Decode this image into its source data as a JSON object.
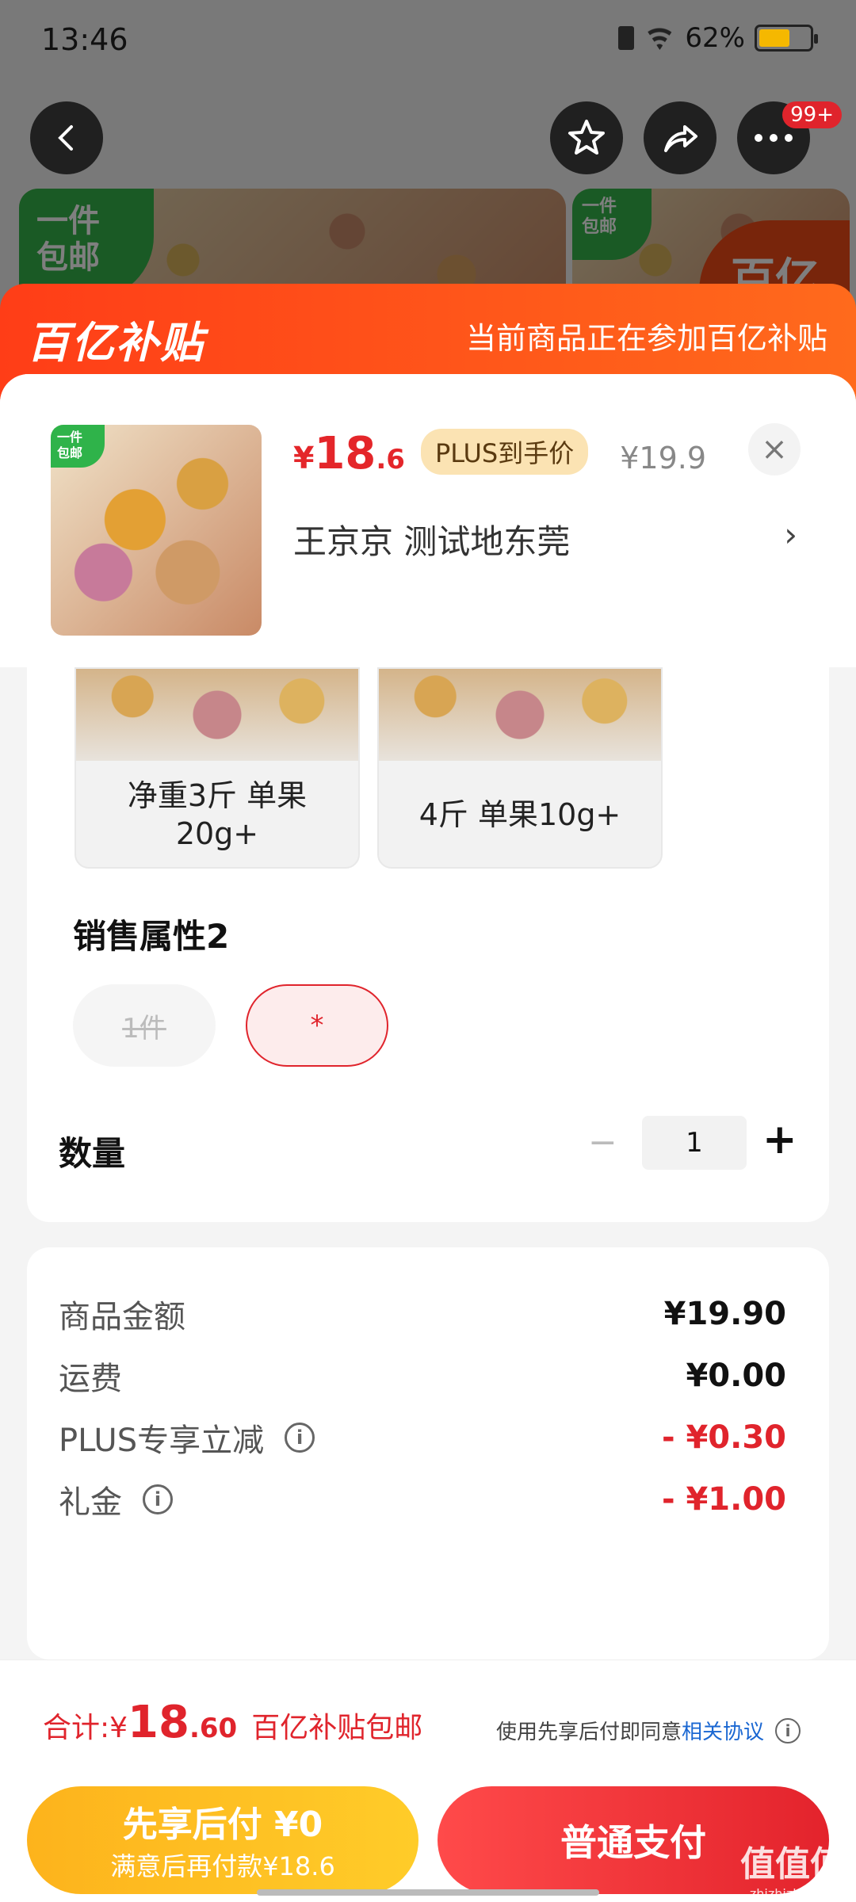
{
  "status_bar": {
    "time": "13:46",
    "battery": "62%"
  },
  "top_nav": {
    "more_badge": "99+"
  },
  "background": {
    "tag_line1": "一件",
    "tag_line2": "包邮",
    "logo_text": "百亿"
  },
  "sheet_header": {
    "brand": "百亿补贴",
    "notice": "当前商品正在参加百亿补贴"
  },
  "product": {
    "thumb_tag_line1": "一件",
    "thumb_tag_line2": "包邮",
    "price_symbol": "¥",
    "price_int": "18",
    "price_dec": ".6",
    "plus_badge": "PLUS到手价",
    "original_price": "¥19.9",
    "address": "王京京  测试地东莞",
    "close": "×",
    "chevron": "›"
  },
  "spec": {
    "options": [
      "净重3斤 单果20g+",
      "4斤 单果10g+"
    ],
    "attr2_title": "销售属性2",
    "attr2_pills": [
      "1件",
      "*"
    ],
    "qty_label": "数量",
    "qty_value": "1",
    "minus": "−",
    "plus": "+"
  },
  "summary": {
    "rows": [
      {
        "label": "商品金额",
        "value": "¥19.90"
      },
      {
        "label": "运费",
        "value": "¥0.00"
      },
      {
        "label": "PLUS专享立减",
        "value": "- ¥0.30"
      },
      {
        "label": "礼金",
        "value": "- ¥1.00"
      }
    ]
  },
  "total": {
    "label": "合计: ",
    "symbol": "¥",
    "amount_int": "18",
    "amount_dec": ".60",
    "shipping": "百亿补贴包邮",
    "agree_prefix": "使用先享后付即同意",
    "agree_link": "相关协议"
  },
  "actions": {
    "bnpl_line1": "先享后付 ¥0",
    "bnpl_line2": "满意后再付款¥18.6",
    "pay": "普通支付"
  },
  "watermark": {
    "text": "值值值",
    "sub": "zhizhizhi.com"
  },
  "colors": {
    "accent_red": "#e0242c",
    "subsidy_orange": "#ff4a1a",
    "bnpl_yellow": "#fdb31c",
    "plus_gold": "#fbe3b3"
  }
}
